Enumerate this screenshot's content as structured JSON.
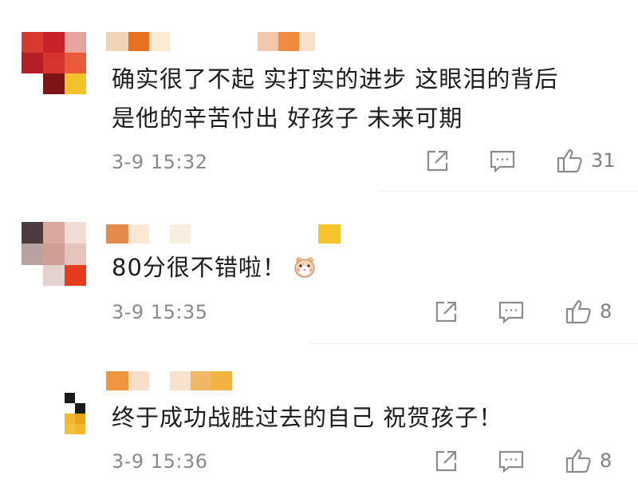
{
  "comments": [
    {
      "text_lines": [
        "确实很了不起 实打实的进步 这眼泪的背后",
        "是他的辛苦付出 好孩子 未来可期"
      ],
      "time": "3-9 15:32",
      "likes": "31",
      "emoji": ""
    },
    {
      "text_lines": [
        "80分很不错啦！"
      ],
      "time": "3-9 15:35",
      "likes": "8",
      "emoji": "hamster-emoji"
    },
    {
      "text_lines": [
        "终于成功战胜过去的自己 祝贺孩子！"
      ],
      "time": "3-9 15:36",
      "likes": "8",
      "emoji": ""
    }
  ],
  "icons": {
    "share": "share-icon",
    "reply": "comment-icon",
    "like": "thumbs-up-icon"
  },
  "colors": {
    "text": "#1c1c1c",
    "meta": "#8a8a8a",
    "icon": "#8c8c8c",
    "divider": "#eeeeee"
  }
}
